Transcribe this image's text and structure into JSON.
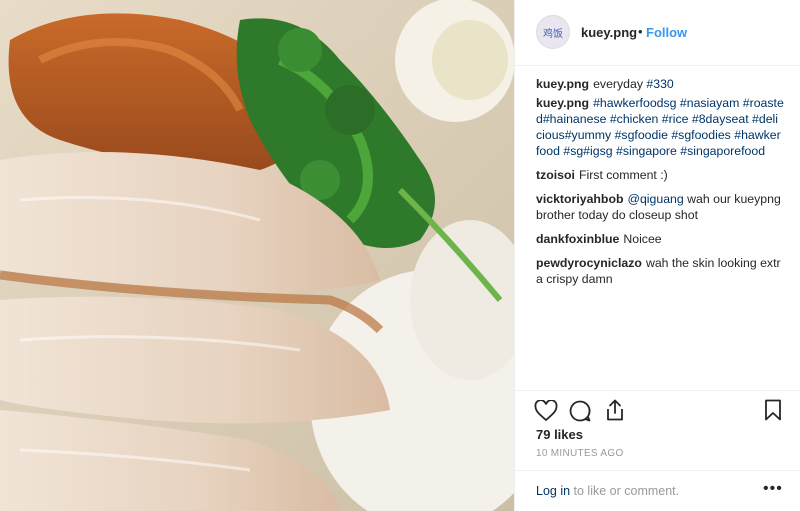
{
  "post": {
    "username": "kuey.png",
    "follow_label": "Follow",
    "separator": "•",
    "avatar_text": "鸡饭"
  },
  "comments": [
    {
      "user": "kuey.png",
      "text": "everyday ",
      "tags": "#330"
    },
    {
      "user": "kuey.png",
      "text": "",
      "tags": "#hawkerfoodsg #nasiayam #roasted#hainanese #chicken #rice #8dayseat #delicious#yummy #sgfoodie #sgfoodies #hawkerfood #sg#igsg #singapore #singaporefood"
    },
    {
      "user": "tzoisoi",
      "text": "First comment :)",
      "tags": ""
    },
    {
      "user": "vicktoriyahbob",
      "text": " wah our kueypng brother today do closeup shot",
      "tags": "@qiguang"
    },
    {
      "user": "dankfoxinblue",
      "text": "Noicee",
      "tags": ""
    },
    {
      "user": "pewdyrocyniclazo",
      "text": "wah the skin looking extra crispy damn",
      "tags": ""
    }
  ],
  "stats": {
    "likes": "79 likes",
    "time": "10 MINUTES AGO"
  },
  "login": {
    "link": "Log in",
    "rest": " to like or comment.",
    "more": "•••"
  },
  "icons": {
    "like": "heart-icon",
    "comment": "comment-icon",
    "share": "share-icon",
    "save": "bookmark-icon",
    "more": "more-options-icon"
  }
}
